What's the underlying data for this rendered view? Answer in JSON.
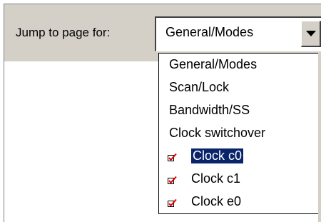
{
  "form": {
    "jump_label": "Jump to page for:"
  },
  "combo": {
    "selected_value": "General/Modes",
    "button_icon": "chevron-down-icon"
  },
  "dropdown": {
    "items": [
      {
        "label": "General/Modes",
        "checked": false,
        "highlighted": false
      },
      {
        "label": "Scan/Lock",
        "checked": false,
        "highlighted": false
      },
      {
        "label": "Bandwidth/SS",
        "checked": false,
        "highlighted": false
      },
      {
        "label": "Clock switchover",
        "checked": false,
        "highlighted": false
      },
      {
        "label": "Clock c0",
        "checked": true,
        "highlighted": true
      },
      {
        "label": "Clock c1",
        "checked": true,
        "highlighted": false
      },
      {
        "label": "Clock e0",
        "checked": true,
        "highlighted": false
      }
    ]
  },
  "colors": {
    "highlight_bg": "#0a246a",
    "check_red": "#e00000",
    "panel_gray": "#d4d0c8"
  }
}
